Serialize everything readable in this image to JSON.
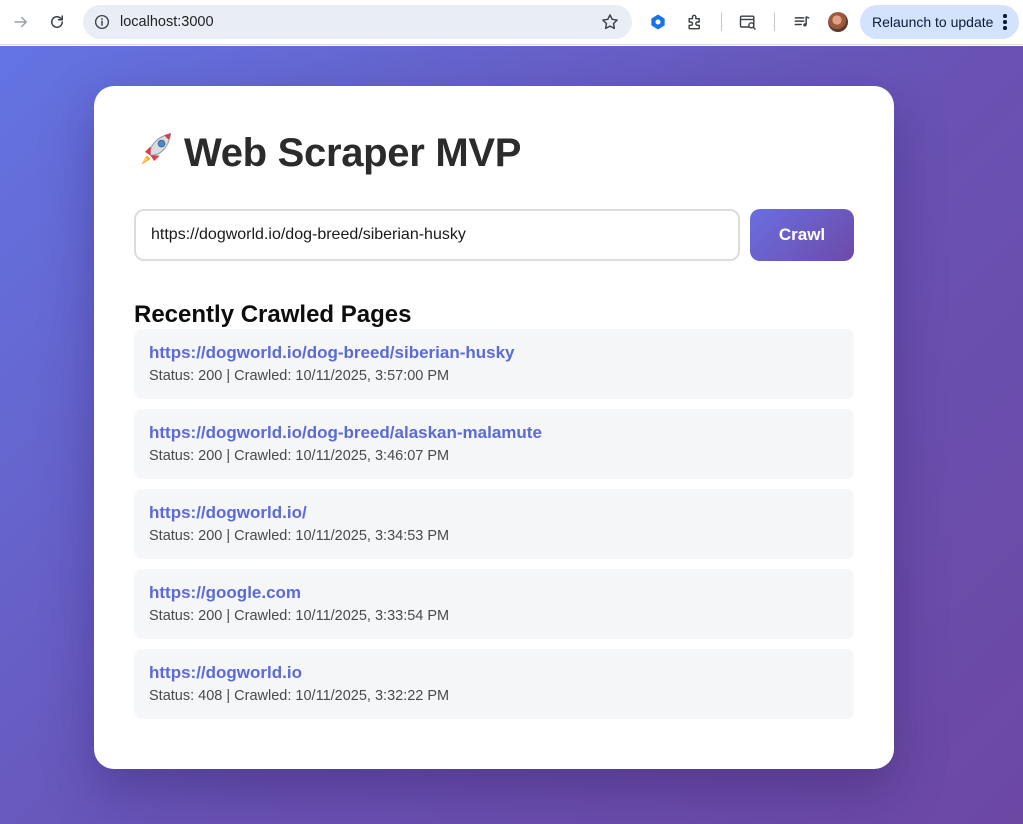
{
  "browser": {
    "url": "localhost:3000",
    "relaunch_label": "Relaunch to update",
    "icons": [
      "forward-icon",
      "reload-icon",
      "info-icon",
      "star-icon",
      "extension-icon",
      "puzzle-icon",
      "search-tab-icon",
      "media-icon",
      "avatar",
      "more-icon"
    ]
  },
  "page": {
    "title": "Web Scraper MVP",
    "title_icon": "rocket-icon",
    "url_input_value": "https://dogworld.io/dog-breed/siberian-husky",
    "crawl_label": "Crawl",
    "recent_heading": "Recently Crawled Pages",
    "accent_color": "#5b6ad6",
    "recent": [
      {
        "url": "https://dogworld.io/dog-breed/siberian-husky",
        "meta": "Status: 200 | Crawled: 10/11/2025, 3:57:00 PM"
      },
      {
        "url": "https://dogworld.io/dog-breed/alaskan-malamute",
        "meta": "Status: 200 | Crawled: 10/11/2025, 3:46:07 PM"
      },
      {
        "url": "https://dogworld.io/",
        "meta": "Status: 200 | Crawled: 10/11/2025, 3:34:53 PM"
      },
      {
        "url": "https://google.com",
        "meta": "Status: 200 | Crawled: 10/11/2025, 3:33:54 PM"
      },
      {
        "url": "https://dogworld.io",
        "meta": "Status: 408 | Crawled: 10/11/2025, 3:32:22 PM"
      }
    ]
  }
}
